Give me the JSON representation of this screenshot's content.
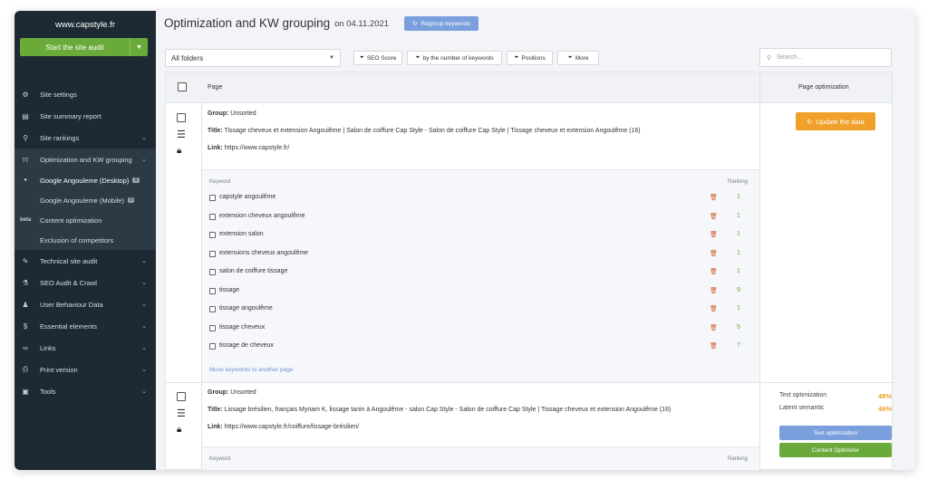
{
  "sidebar": {
    "brand": "www.capstyle.fr",
    "audit_button": "Start the site audit",
    "items": [
      {
        "icon": "gear-icon",
        "glyph": "⚙",
        "label": "Site settings",
        "chev": ""
      },
      {
        "icon": "report-icon",
        "glyph": "▤",
        "label": "Site summary report",
        "chev": ""
      },
      {
        "icon": "search-icon",
        "glyph": "⚲",
        "label": "Site rankings",
        "chev": "⌄"
      },
      {
        "icon": "tt-icon",
        "glyph": "ᴛᴛ",
        "label": "Optimization and KW grouping",
        "chev": "⌄"
      }
    ],
    "sub_items": [
      {
        "label": "Google Angouleme (Desktop)",
        "badge": "9"
      },
      {
        "label": "Google Angouleme (Mobile)",
        "badge": "9"
      },
      {
        "label": "Content optimization",
        "beta": "beta"
      },
      {
        "label": "Exclusion of competitors"
      }
    ],
    "items2": [
      {
        "icon": "wrench-icon",
        "glyph": "🔧",
        "label": "Technical site audit",
        "chev": "⌄"
      },
      {
        "icon": "flask-icon",
        "glyph": "⚗",
        "label": "SEO Audit & Crawl",
        "chev": "⌄"
      },
      {
        "icon": "user-icon",
        "glyph": "♟",
        "label": "User Behaviour Data",
        "chev": "⌄"
      },
      {
        "icon": "dollar-icon",
        "glyph": "$",
        "label": "Essential elements",
        "chev": "⌄"
      },
      {
        "icon": "link-icon",
        "glyph": "∞",
        "label": "Links",
        "chev": "⌄"
      },
      {
        "icon": "print-icon",
        "glyph": "⎙",
        "label": "Print version",
        "chev": "⌄"
      },
      {
        "icon": "briefcase-icon",
        "glyph": "▣",
        "label": "Tools",
        "chev": "⌄"
      }
    ]
  },
  "header": {
    "title": "Optimization and KW grouping",
    "date": "on 04.11.2021",
    "regroup": "Regroup keywords"
  },
  "toolbar": {
    "folder": "All folders",
    "filters": [
      "SEO Score",
      "by the number of keywords",
      "Positions",
      "More"
    ],
    "search_placeholder": "Search..."
  },
  "table": {
    "col_page": "Page",
    "col_opt": "Page optimization",
    "rows": [
      {
        "group_label": "Group:",
        "group": "Unsorted",
        "title_label": "Title:",
        "title": "Tissage cheveux et extension Angoulême | Salon de coiffure Cap Style - Salon de coiffure Cap Style | Tissage cheveux et extension Angoulême (16)",
        "link_label": "Link:",
        "link": "https://www.capstyle.fr/",
        "update": "Update the data",
        "kw_header": "Keyword",
        "rank_header": "Ranking",
        "keywords": [
          {
            "kw": "capstyle angoulême",
            "rank": "1"
          },
          {
            "kw": "extension cheveux angoulême",
            "rank": "1"
          },
          {
            "kw": "extension salon",
            "rank": "1"
          },
          {
            "kw": "extensions cheveux angoulême",
            "rank": "1"
          },
          {
            "kw": "salon de coiffure tissage",
            "rank": "1"
          },
          {
            "kw": "tissage",
            "rank": "9"
          },
          {
            "kw": "tissage angoulême",
            "rank": "1"
          },
          {
            "kw": "tissage cheveux",
            "rank": "5"
          },
          {
            "kw": "tissage de cheveux",
            "rank": "7"
          }
        ],
        "move": "Move keywords to another page"
      },
      {
        "group_label": "Group:",
        "group": "Unsorted",
        "title_label": "Title:",
        "title": "Lissage brésilien, français Myriam K, lissage tanin à Angoulême - salon Cap Style - Salon de coiffure Cap Style | Tissage cheveux et extension Angoulême (16)",
        "link_label": "Link:",
        "link": "https://www.capstyle.fr/coiffure/lissage-brésilien/",
        "text_opt_label": "Text optimization",
        "text_opt": "48%",
        "latent_label": "Latent semantic",
        "latent": "46%",
        "btn_text_opt": "Text optimization",
        "btn_content": "Content Optimizer",
        "kw_header": "Keyword",
        "rank_header": "Ranking"
      }
    ]
  },
  "colors": {
    "accent_green": "#6aaa3a",
    "accent_orange": "#efa12a",
    "accent_blue": "#7b9fdc",
    "sidebar_bg": "#1d2a33"
  }
}
